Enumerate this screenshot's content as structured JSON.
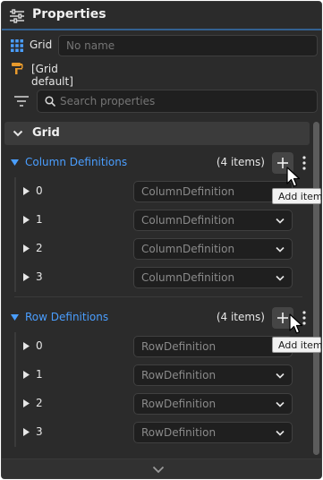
{
  "header": {
    "title": "Properties",
    "icon": "sliders-icon"
  },
  "element": {
    "type_label": "Grid",
    "name_placeholder": "No name",
    "style_label": "[Grid default]"
  },
  "search": {
    "placeholder": "Search properties"
  },
  "section": {
    "title": "Grid"
  },
  "column_definitions": {
    "title": "Column Definitions",
    "count": "(4 items)",
    "add_tooltip": "Add item",
    "items": [
      {
        "index": "0",
        "value": "ColumnDefinition"
      },
      {
        "index": "1",
        "value": "ColumnDefinition"
      },
      {
        "index": "2",
        "value": "ColumnDefinition"
      },
      {
        "index": "3",
        "value": "ColumnDefinition"
      }
    ]
  },
  "row_definitions": {
    "title": "Row Definitions",
    "count": "(4 items)",
    "add_tooltip": "Add item",
    "items": [
      {
        "index": "0",
        "value": "RowDefinition"
      },
      {
        "index": "1",
        "value": "RowDefinition"
      },
      {
        "index": "2",
        "value": "RowDefinition"
      },
      {
        "index": "3",
        "value": "RowDefinition"
      }
    ]
  },
  "colors": {
    "accent": "#4a9eff",
    "panel_bg": "#2b2b2b",
    "field_bg": "#1f1f1f",
    "header_bg": "#3b3b3b"
  }
}
